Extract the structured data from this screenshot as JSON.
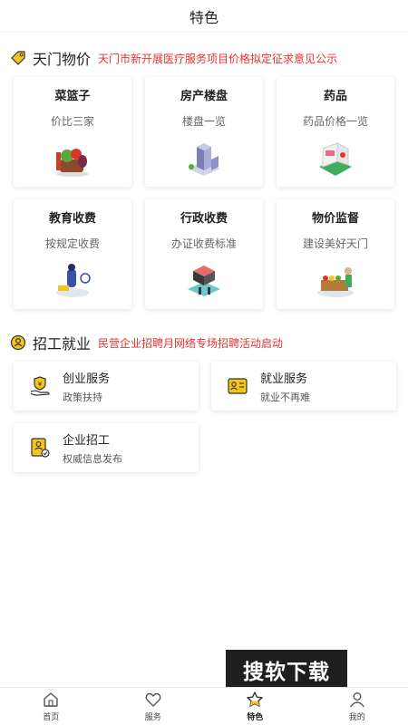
{
  "header": {
    "title": "特色"
  },
  "price_section": {
    "icon": "price-tag-icon",
    "title": "天门物价",
    "notice": "天门市新开展医疗服务项目价格拟定征求意见公示",
    "cards": [
      {
        "title": "菜篮子",
        "subtitle": "价比三家",
        "icon": "vegetable-basket-icon"
      },
      {
        "title": "房产楼盘",
        "subtitle": "楼盘一览",
        "icon": "building-icon"
      },
      {
        "title": "药品",
        "subtitle": "药品价格一览",
        "icon": "pharmacy-icon"
      },
      {
        "title": "教育收费",
        "subtitle": "按规定收费",
        "icon": "education-icon"
      },
      {
        "title": "行政收费",
        "subtitle": "办证收费标准",
        "icon": "admin-office-icon"
      },
      {
        "title": "物价监督",
        "subtitle": "建设美好天门",
        "icon": "market-stall-icon"
      }
    ]
  },
  "job_section": {
    "icon": "job-search-icon",
    "title": "招工就业",
    "notice": "民营企业招聘月网络专场招聘活动启动",
    "cards": [
      {
        "title": "创业服务",
        "subtitle": "政策扶持",
        "icon": "hand-shield-icon"
      },
      {
        "title": "就业服务",
        "subtitle": "就业不再难",
        "icon": "id-card-icon"
      },
      {
        "title": "企业招工",
        "subtitle": "权威信息发布",
        "icon": "recruit-document-icon"
      }
    ]
  },
  "watermark": {
    "text": "搜软下载"
  },
  "tabbar": {
    "active": "特色",
    "tabs": [
      {
        "label": "首页",
        "icon": "home-icon"
      },
      {
        "label": "服务",
        "icon": "heart-icon"
      },
      {
        "label": "特色",
        "icon": "star-icon"
      },
      {
        "label": "我的",
        "icon": "user-icon"
      }
    ]
  },
  "colors": {
    "notice_red": "#e8322f",
    "accent_yellow": "#f5c518"
  }
}
